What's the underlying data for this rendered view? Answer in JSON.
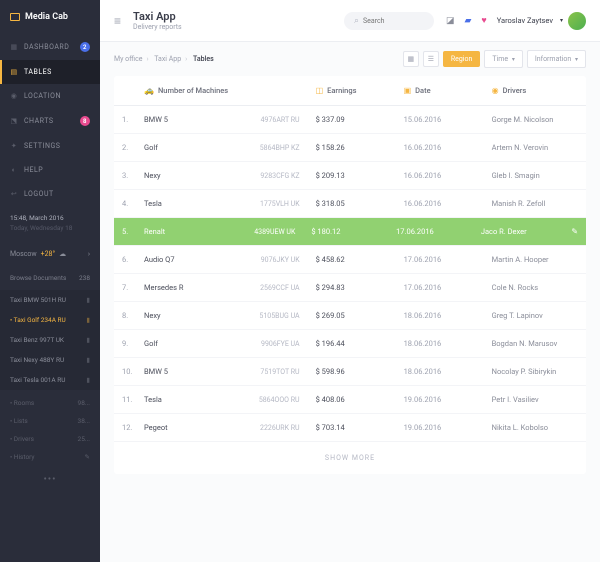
{
  "brand": {
    "name": "Media Cab"
  },
  "sidebar": {
    "nav": [
      {
        "label": "DASHBOARD",
        "badge": "2",
        "badgeColor": "blue",
        "icon": "▦"
      },
      {
        "label": "TABLES",
        "icon": "▤",
        "active": true
      },
      {
        "label": "LOCATION",
        "icon": "◉"
      },
      {
        "label": "CHARTS",
        "badge": "8",
        "badgeColor": "pink",
        "icon": "⬔"
      },
      {
        "label": "SETTINGS",
        "icon": "✦"
      },
      {
        "label": "HELP",
        "icon": "◐"
      },
      {
        "label": "LOGOUT",
        "icon": "↩"
      }
    ],
    "date": "15:48, March 2016",
    "today": "Today, Wednesday 18",
    "weather": {
      "city": "Moscow",
      "temp": "+28°"
    },
    "browse": {
      "label": "Browse Documents",
      "count": "238"
    },
    "docs": [
      {
        "label": "Taxi BMW 501H RU"
      },
      {
        "label": "Taxi Golf 234A RU",
        "hl": true
      },
      {
        "label": "Taxi Benz 997T UK"
      },
      {
        "label": "Taxi Nexy 488Y RU"
      },
      {
        "label": "Taxi Tesla 001A RU"
      }
    ],
    "cats": [
      {
        "label": "Rooms",
        "count": "98..."
      },
      {
        "label": "Lists",
        "count": "38..."
      },
      {
        "label": "Drivers",
        "count": "25..."
      },
      {
        "label": "History",
        "count": "✎"
      }
    ]
  },
  "header": {
    "title": "Taxi App",
    "subtitle": "Delivery reports"
  },
  "search": {
    "placeholder": "Search"
  },
  "user": {
    "name": "Yaroslav Zaytsev"
  },
  "breadcrumb": {
    "a": "My office",
    "b": "Taxi App",
    "c": "Tables"
  },
  "buttons": {
    "region": "Region",
    "time": "Time",
    "info": "Information"
  },
  "columns": {
    "machines": "Number of Machines",
    "earnings": "Earnings",
    "date": "Date",
    "drivers": "Drivers"
  },
  "rows": [
    {
      "n": "1.",
      "name": "BMW 5",
      "code": "4976ART RU",
      "earn": "$ 337.09",
      "date": "15.06.2016",
      "driver": "Gorge M. Nicolson"
    },
    {
      "n": "2.",
      "name": "Golf",
      "code": "5864BHP KZ",
      "earn": "$ 158.26",
      "date": "16.06.2016",
      "driver": "Artem N. Verovin"
    },
    {
      "n": "3.",
      "name": "Nexy",
      "code": "9283CFG KZ",
      "earn": "$ 209.13",
      "date": "16.06.2016",
      "driver": "Gleb I. Smagin"
    },
    {
      "n": "4.",
      "name": "Tesla",
      "code": "1775VLH UK",
      "earn": "$ 318.05",
      "date": "16.06.2016",
      "driver": "Manish R. Zefoll"
    },
    {
      "n": "5.",
      "name": "Renalt",
      "code": "4389UEW UK",
      "earn": "$ 180.12",
      "date": "17.06.2016",
      "driver": "Jaco R. Dexer",
      "hl": true
    },
    {
      "n": "6.",
      "name": "Audio Q7",
      "code": "9076JKY UK",
      "earn": "$ 458.62",
      "date": "17.06.2016",
      "driver": "Martin A. Hooper"
    },
    {
      "n": "7.",
      "name": "Mersedes R",
      "code": "2569CCF UA",
      "earn": "$ 294.83",
      "date": "17.06.2016",
      "driver": "Cole N. Rocks"
    },
    {
      "n": "8.",
      "name": "Nexy",
      "code": "5105BUG UA",
      "earn": "$ 269.05",
      "date": "18.06.2016",
      "driver": "Greg T. Lapinov"
    },
    {
      "n": "9.",
      "name": "Golf",
      "code": "9906FYE UA",
      "earn": "$ 196.44",
      "date": "18.06.2016",
      "driver": "Bogdan N. Marusov"
    },
    {
      "n": "10.",
      "name": "BMW 5",
      "code": "7519TOT RU",
      "earn": "$ 598.96",
      "date": "18.06.2016",
      "driver": "Nocolay P. Sibirykin"
    },
    {
      "n": "11.",
      "name": "Tesla",
      "code": "5864OOO RU",
      "earn": "$ 408.06",
      "date": "19.06.2016",
      "driver": "Petr I. Vasiliev"
    },
    {
      "n": "12.",
      "name": "Pegeot",
      "code": "2226URK RU",
      "earn": "$ 703.14",
      "date": "19.06.2016",
      "driver": "Nikita L. Kobolso"
    }
  ],
  "showMore": "SHOW MORE"
}
